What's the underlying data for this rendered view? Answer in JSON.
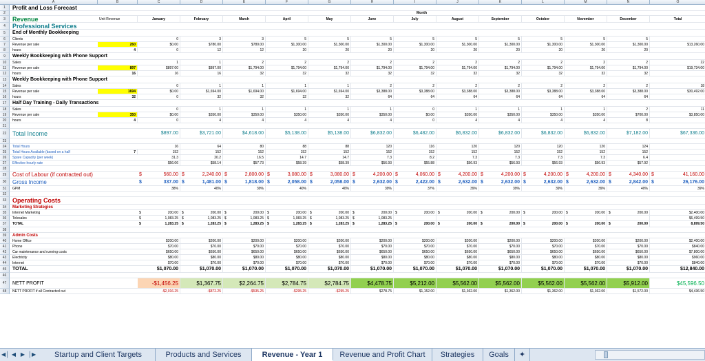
{
  "columns": [
    "A",
    "B",
    "C",
    "D",
    "E",
    "F",
    "G",
    "H",
    "I",
    "J",
    "K",
    "L",
    "M",
    "N",
    "O"
  ],
  "months": [
    "January",
    "February",
    "March",
    "April",
    "May",
    "June",
    "July",
    "August",
    "September",
    "October",
    "November",
    "December",
    "Total"
  ],
  "header": {
    "title": "Profit and Loss Forecast",
    "month_label": "Month",
    "revenue": "Revenue",
    "unit_revenue": "Unit Revenue"
  },
  "rows": [
    {
      "n": "4",
      "label": "Professional Services",
      "style": "sec"
    },
    {
      "n": "5",
      "label": "End of Monthly Bookkeeping",
      "style": "sub"
    },
    {
      "n": "6",
      "label": "Clients",
      "vals": [
        "0",
        "3",
        "3",
        "5",
        "5",
        "5",
        "5",
        "5",
        "5",
        "5",
        "5",
        "5",
        ""
      ]
    },
    {
      "n": "7",
      "label": "Revenue per sale",
      "b": "260",
      "bY": true,
      "vals": [
        "$0.00",
        "$780.00",
        "$780.00",
        "$1,300.00",
        "$1,300.00",
        "$1,300.00",
        "$1,300.00",
        "$1,300.00",
        "$1,300.00",
        "$1,300.00",
        "$1,300.00",
        "$1,300.00",
        "$13,260.00"
      ]
    },
    {
      "n": "8",
      "label": "hours",
      "b": "4",
      "vals": [
        "0",
        "12",
        "12",
        "20",
        "20",
        "20",
        "20",
        "20",
        "20",
        "20",
        "20",
        "20",
        ""
      ]
    },
    {
      "n": "9",
      "label": "Weekly Bookkeeping with Phone Support",
      "style": "sub"
    },
    {
      "n": "10",
      "label": "Sales",
      "vals": [
        "1",
        "1",
        "2",
        "2",
        "2",
        "2",
        "2",
        "2",
        "2",
        "2",
        "2",
        "2",
        "22"
      ]
    },
    {
      "n": "11",
      "label": "Revenue per sale",
      "b": "897",
      "bY": true,
      "vals": [
        "$897.00",
        "$897.00",
        "$1,794.00",
        "$1,794.00",
        "$1,794.00",
        "$1,794.00",
        "$1,794.00",
        "$1,794.00",
        "$1,794.00",
        "$1,794.00",
        "$1,794.00",
        "$1,794.00",
        "$19,734.00"
      ]
    },
    {
      "n": "12",
      "label": "hours",
      "b": "16",
      "vals": [
        "16",
        "16",
        "32",
        "32",
        "32",
        "32",
        "32",
        "32",
        "32",
        "32",
        "32",
        "32",
        ""
      ]
    },
    {
      "n": "13",
      "label": "Weekly Bookkeeping with Phone Support",
      "style": "sub"
    },
    {
      "n": "14",
      "label": "Sales",
      "vals": [
        "0",
        "1",
        "1",
        "1",
        "1",
        "2",
        "2",
        "2",
        "2",
        "2",
        "2",
        "2",
        "18"
      ]
    },
    {
      "n": "15",
      "label": "Revenue per sale",
      "b": "1694",
      "bY": true,
      "vals": [
        "$0.00",
        "$1,694.00",
        "$1,694.00",
        "$1,694.00",
        "$1,694.00",
        "$3,388.00",
        "$3,388.00",
        "$3,388.00",
        "$3,388.00",
        "$3,388.00",
        "$3,388.00",
        "$3,388.00",
        "$30,492.00"
      ]
    },
    {
      "n": "16",
      "label": "hours",
      "b": "32",
      "vals": [
        "0",
        "32",
        "32",
        "32",
        "32",
        "64",
        "64",
        "64",
        "64",
        "64",
        "64",
        "64",
        ""
      ]
    },
    {
      "n": "17",
      "label": "Half Day Training - Daily Transactions",
      "style": "sub"
    },
    {
      "n": "18",
      "label": "Sales",
      "vals": [
        "0",
        "1",
        "1",
        "1",
        "1",
        "1",
        "0",
        "1",
        "1",
        "1",
        "1",
        "2",
        "11"
      ]
    },
    {
      "n": "19",
      "label": "Revenue per sale",
      "b": "350",
      "bY": true,
      "vals": [
        "$0.00",
        "$350.00",
        "$350.00",
        "$350.00",
        "$350.00",
        "$350.00",
        "$0.00",
        "$350.00",
        "$350.00",
        "$350.00",
        "$350.00",
        "$700.00",
        "$3,850.00"
      ]
    },
    {
      "n": "20",
      "label": "hours",
      "b": "4",
      "vals": [
        "0",
        "4",
        "4",
        "4",
        "4",
        "4",
        "0",
        "4",
        "4",
        "4",
        "4",
        "8",
        ""
      ]
    },
    {
      "n": "21",
      "label": "",
      "vals": []
    },
    {
      "n": "22",
      "label": "Total Income",
      "style": "teal",
      "vals": [
        "$897.00",
        "$3,721.00",
        "$4,618.00",
        "$5,138.00",
        "$5,138.00",
        "$6,832.00",
        "$6,482.00",
        "$6,832.00",
        "$6,832.00",
        "$6,832.00",
        "$6,832.00",
        "$7,182.00",
        "$67,336.00"
      ]
    },
    {
      "n": "23",
      "label": "",
      "vals": []
    },
    {
      "n": "24",
      "label": "Total Hours",
      "style": "blue",
      "vals": [
        "16",
        "64",
        "80",
        "88",
        "88",
        "120",
        "116",
        "120",
        "120",
        "120",
        "120",
        "124",
        ""
      ]
    },
    {
      "n": "25",
      "label": "Total Hours Available (based on a half",
      "style": "blue",
      "b": "7",
      "vals": [
        "152",
        "152",
        "152",
        "152",
        "152",
        "152",
        "152",
        "152",
        "152",
        "152",
        "152",
        "152",
        ""
      ]
    },
    {
      "n": "26",
      "label": "Spare Capacity (per week)",
      "style": "blue",
      "vals": [
        "31.3",
        "20.2",
        "16.5",
        "14.7",
        "14.7",
        "7.3",
        "8.2",
        "7.3",
        "7.3",
        "7.3",
        "7.3",
        "6.4",
        ""
      ]
    },
    {
      "n": "27",
      "label": "Effective hourly rate",
      "style": "blue",
      "vals": [
        "$56.06",
        "$58.14",
        "$57.73",
        "$58.39",
        "$58.39",
        "$56.93",
        "$55.88",
        "$56.93",
        "$56.93",
        "$56.93",
        "$56.93",
        "$57.92",
        ""
      ]
    },
    {
      "n": "28",
      "label": "",
      "vals": []
    },
    {
      "n": "29",
      "label": "Cost of Labour (if contracted out)",
      "style": "red",
      "cur": true,
      "vals": [
        "560.00",
        "2,240.00",
        "2,800.00",
        "3,080.00",
        "3,080.00",
        "4,200.00",
        "4,060.00",
        "4,200.00",
        "4,200.00",
        "4,200.00",
        "4,200.00",
        "4,340.00",
        "41,160.00"
      ]
    },
    {
      "n": "30",
      "label": "Gross Income",
      "style": "gross",
      "cur": true,
      "vals": [
        "337.00",
        "1,481.00",
        "1,818.00",
        "2,058.00",
        "2,058.00",
        "2,632.00",
        "2,422.00",
        "2,632.00",
        "2,632.00",
        "2,632.00",
        "2,632.00",
        "2,842.00",
        "26,176.00"
      ]
    },
    {
      "n": "31",
      "label": "GPM",
      "vals": [
        "38%",
        "40%",
        "39%",
        "40%",
        "40%",
        "39%",
        "37%",
        "39%",
        "39%",
        "39%",
        "39%",
        "40%",
        "39%"
      ]
    },
    {
      "n": "32",
      "label": "",
      "vals": []
    },
    {
      "n": "33",
      "label": "Operating Costs",
      "style": "sec2"
    },
    {
      "n": "34",
      "label": "Marketing Strategies",
      "style": "redsub"
    },
    {
      "n": "35",
      "label": "Internet Marketing",
      "cur": true,
      "vals": [
        "200.00",
        "200.00",
        "200.00",
        "200.00",
        "200.00",
        "200.00",
        "200.00",
        "200.00",
        "200.00",
        "200.00",
        "200.00",
        "200.00",
        "$2,400.00"
      ]
    },
    {
      "n": "36",
      "label": "Telesales",
      "cur": true,
      "vals": [
        "1,083.25",
        "1,083.25",
        "1,083.25",
        "1,083.25",
        "1,083.25",
        "1,083.25",
        "",
        "",
        "",
        "",
        "",
        "",
        "$6,499.50"
      ]
    },
    {
      "n": "37",
      "label": "TOTAL",
      "style": "boldsmall",
      "cur": true,
      "vals": [
        "1,283.25",
        "1,283.25",
        "1,283.25",
        "1,283.25",
        "1,283.25",
        "1,283.25",
        "200.00",
        "200.00",
        "200.00",
        "200.00",
        "200.00",
        "200.00",
        "8,899.50"
      ]
    },
    {
      "n": "38",
      "label": "",
      "vals": []
    },
    {
      "n": "39",
      "label": "Admin Costs",
      "style": "redsub"
    },
    {
      "n": "40",
      "label": "Home Office",
      "vals": [
        "$200.00",
        "$200.00",
        "$200.00",
        "$200.00",
        "$200.00",
        "$200.00",
        "$200.00",
        "$200.00",
        "$200.00",
        "$200.00",
        "$200.00",
        "$200.00",
        "$2,400.00"
      ]
    },
    {
      "n": "41",
      "label": "Phone",
      "vals": [
        "$70.00",
        "$70.00",
        "$70.00",
        "$70.00",
        "$70.00",
        "$70.00",
        "$70.00",
        "$70.00",
        "$70.00",
        "$70.00",
        "$70.00",
        "$70.00",
        "$840.00"
      ]
    },
    {
      "n": "42",
      "label": "Car maintenance and running costs",
      "vals": [
        "$650.00",
        "$650.00",
        "$650.00",
        "$650.00",
        "$650.00",
        "$650.00",
        "$650.00",
        "$650.00",
        "$650.00",
        "$650.00",
        "$650.00",
        "$650.00",
        "$7,800.00"
      ]
    },
    {
      "n": "43",
      "label": "Electricity",
      "vals": [
        "$80.00",
        "$80.00",
        "$80.00",
        "$80.00",
        "$80.00",
        "$80.00",
        "$80.00",
        "$80.00",
        "$80.00",
        "$80.00",
        "$80.00",
        "$80.00",
        "$960.00"
      ]
    },
    {
      "n": "44",
      "label": "Internet",
      "vals": [
        "$70.00",
        "$70.00",
        "$70.00",
        "$70.00",
        "$70.00",
        "$70.00",
        "$70.00",
        "$70.00",
        "$70.00",
        "$70.00",
        "$70.00",
        "$70.00",
        "$840.00"
      ]
    },
    {
      "n": "45",
      "label": "TOTAL",
      "style": "total",
      "vals": [
        "$1,070.00",
        "$1,070.00",
        "$1,070.00",
        "$1,070.00",
        "$1,070.00",
        "$1,070.00",
        "$1,070.00",
        "$1,070.00",
        "$1,070.00",
        "$1,070.00",
        "$1,070.00",
        "$1,070.00",
        "$12,840.00"
      ]
    },
    {
      "n": "46",
      "label": "",
      "vals": []
    },
    {
      "n": "47",
      "label": "NETT PROFIT",
      "style": "nett",
      "vals": [
        "-$1,456.25",
        "$1,367.75",
        "$2,264.75",
        "$2,784.75",
        "$2,784.75",
        "$4,478.75",
        "$5,212.00",
        "$5,562.00",
        "$5,562.00",
        "$5,562.00",
        "$5,562.00",
        "$5,912.00",
        "$45,596.50"
      ]
    },
    {
      "n": "48",
      "label": "NETT PROFIT if all Contracted out",
      "style": "nettsm",
      "vals": [
        "-$2,016.25",
        "-$872.25",
        "-$535.25",
        "-$295.25",
        "-$295.25",
        "$278.75",
        "$1,152.00",
        "$1,362.00",
        "$1,362.00",
        "$1,362.00",
        "$1,362.00",
        "$1,572.00",
        "$4,436.50"
      ]
    }
  ],
  "tabs": [
    "Startup and Client Targets",
    "Products and Services",
    "Revenue - Year 1",
    "Revenue and Profit Chart",
    "Strategies",
    "Goals"
  ],
  "active_tab": "Revenue - Year 1",
  "colors": {
    "yellow": "#ffff00",
    "green": "#92d050",
    "teal": "#0f7d8c",
    "red": "#c00000",
    "navy": "#1f3864",
    "light_green": "#d4e8b8",
    "peach": "#fcd5b4"
  }
}
